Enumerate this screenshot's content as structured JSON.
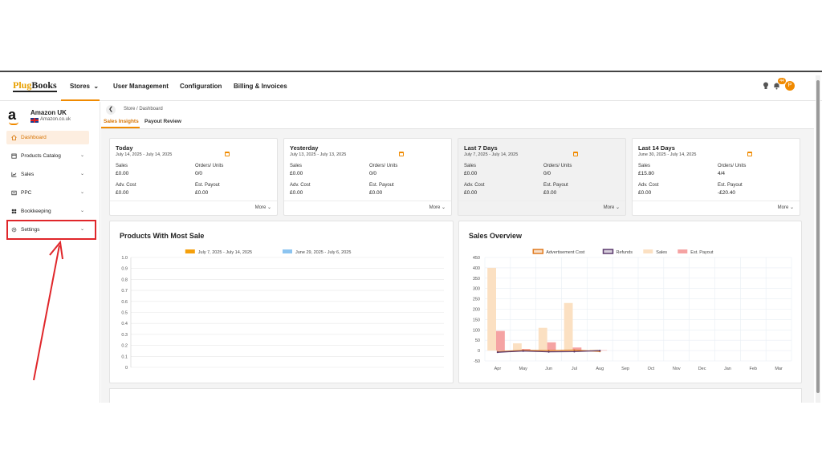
{
  "topnav": {
    "logo_part1": "Plug",
    "logo_part2": "Books",
    "stores": "Stores",
    "user_management": "User Management",
    "configuration": "Configuration",
    "billing": "Billing & Invoices",
    "notification_count": "44",
    "avatar_letter": "P"
  },
  "sidebar": {
    "store_name": "Amazon UK",
    "store_domain": "Amazon.co.uk",
    "items": [
      {
        "label": "Dashboard",
        "icon": "home-icon"
      },
      {
        "label": "Products Catalog",
        "icon": "box-icon"
      },
      {
        "label": "Sales",
        "icon": "chart-icon"
      },
      {
        "label": "PPC",
        "icon": "ppc-icon"
      },
      {
        "label": "Bookkeeping",
        "icon": "book-icon"
      },
      {
        "label": "Settings",
        "icon": "gear-icon"
      }
    ]
  },
  "main": {
    "breadcrumb": "Store  /  Dashboard",
    "tabs": [
      {
        "label": "Sales Insights"
      },
      {
        "label": "Payout Review"
      }
    ],
    "labels": {
      "sales": "Sales",
      "orders_units": "Orders/ Units",
      "adv_cost": "Adv. Cost",
      "est_payout": "Est. Payout",
      "more": "More"
    },
    "cards": [
      {
        "title": "Today",
        "range": "July 14, 2025 - July 14, 2025",
        "sales": "£0.00",
        "orders_units": "0/0",
        "adv_cost": "£0.00",
        "est_payout": "£0.00"
      },
      {
        "title": "Yesterday",
        "range": "July 13, 2025 - July 13, 2025",
        "sales": "£0.00",
        "orders_units": "0/0",
        "adv_cost": "£0.00",
        "est_payout": "£0.00"
      },
      {
        "title": "Last 7 Days",
        "range": "July 7, 2025 - July 14, 2025",
        "sales": "£0.00",
        "orders_units": "0/0",
        "adv_cost": "£0.00",
        "est_payout": "£0.00"
      },
      {
        "title": "Last 14 Days",
        "range": "June 30, 2025 - July 14, 2025",
        "sales": "£15.80",
        "orders_units": "4/4",
        "adv_cost": "£0.00",
        "est_payout": "-£20.40"
      }
    ]
  },
  "chart_data": [
    {
      "type": "bar",
      "title": "Products With Most Sale",
      "categories": [],
      "series": [
        {
          "name": "July 7, 2025 - July 14, 2025",
          "values": [],
          "color": "#f5a00b"
        },
        {
          "name": "June 29, 2025 - July 6, 2025",
          "values": [],
          "color": "#8cc4f0"
        }
      ],
      "yticks": [
        "1.0",
        "0.9",
        "0.8",
        "0.7",
        "0.6",
        "0.5",
        "0.4",
        "0.3",
        "0.2",
        "0.1",
        "0"
      ],
      "ylim": [
        0,
        1
      ],
      "grid": true,
      "legend": "top"
    },
    {
      "type": "bar",
      "title": "Sales Overview",
      "categories": [
        "Apr",
        "May",
        "Jun",
        "Jul",
        "Aug",
        "Sep",
        "Oct",
        "Nov",
        "Dec",
        "Jan",
        "Feb",
        "Mar"
      ],
      "series": [
        {
          "name": "Advertisement Cost",
          "kind": "line",
          "color": "#e07a1f",
          "values": [
            -5,
            1,
            0,
            2,
            -4,
            null,
            null,
            null,
            null,
            null,
            null,
            null
          ]
        },
        {
          "name": "Refunds",
          "kind": "line",
          "color": "#5b3a6e",
          "values": [
            -8,
            -2,
            -6,
            -5,
            0,
            null,
            null,
            null,
            null,
            null,
            null,
            null
          ]
        },
        {
          "name": "Sales",
          "kind": "bar",
          "color": "#fbe0c2",
          "values": [
            400,
            35,
            110,
            230,
            5,
            0,
            0,
            0,
            0,
            0,
            0,
            0
          ]
        },
        {
          "name": "Est. Payout",
          "kind": "bar",
          "color": "#f5a3a3",
          "values": [
            95,
            8,
            40,
            15,
            2,
            0,
            0,
            0,
            0,
            0,
            0,
            0
          ]
        }
      ],
      "yticks": [
        "450",
        "400",
        "350",
        "300",
        "250",
        "200",
        "150",
        "100",
        "50",
        "0",
        "-50"
      ],
      "ylim": [
        -50,
        450
      ],
      "grid": true,
      "legend": "top"
    }
  ]
}
